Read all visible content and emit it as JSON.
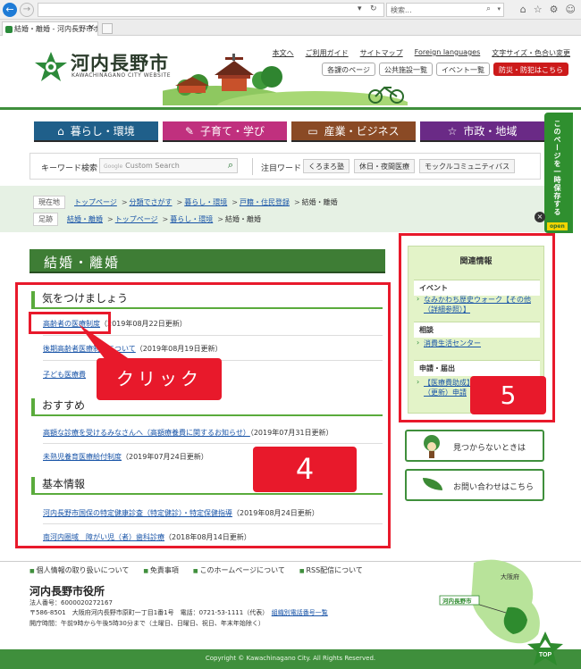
{
  "browser": {
    "search_placeholder": "検索...",
    "tab_title": "結婚・離婚 - 河内長野市ホ..."
  },
  "header": {
    "logo_text": "河内長野市",
    "logo_sub": "KAWACHINAGANO CITY WEBSITE",
    "links": [
      "本文へ",
      "ご利用ガイド",
      "サイトマップ",
      "Foreign languages",
      "文字サイズ・色合い変更"
    ],
    "buttons": [
      "各課のページ",
      "公共施設一覧",
      "イベント一覧"
    ],
    "emergency_button": "防災・防犯はこちら"
  },
  "main_nav": [
    {
      "label": "暮らし・環境",
      "color": "#1f5f8a",
      "icon": "home-icon"
    },
    {
      "label": "子育て・学び",
      "color": "#c0307e",
      "icon": "pencil-icon"
    },
    {
      "label": "産業・ビジネス",
      "color": "#8a4a25",
      "icon": "briefcase-icon"
    },
    {
      "label": "市政・地域",
      "color": "#6a2a86",
      "icon": "star-icon"
    }
  ],
  "search": {
    "keyword_label": "キーワード検索",
    "input_brand": "Google",
    "input_placeholder": "Custom Search",
    "attention_label": "注目ワード",
    "attention_items": [
      "くろまろ塾",
      "休日・夜間医療",
      "モックルコミュニティバス"
    ]
  },
  "breadcrumb": {
    "current_tag": "現在地",
    "current": [
      "トップページ",
      "分類でさがす",
      "暮らし・環境",
      "戸籍・住民登録",
      "結婚・離婚"
    ],
    "history_tag": "足跡",
    "history": [
      "結婚・離婚",
      "トップページ",
      "暮らし・環境",
      "結婚・離婚"
    ]
  },
  "save_tab": {
    "label": "このページを一時保存する",
    "open": "open"
  },
  "page_title": "結婚・離婚",
  "sections": [
    {
      "heading": "気をつけましょう",
      "items": [
        {
          "link": "高齢者の医療制度",
          "date": "（2019年08月22日更新）"
        },
        {
          "link": "後期高齢者医療制度について",
          "date": "（2019年08月19日更新）"
        },
        {
          "link": "子ども医療費",
          "date": ""
        }
      ]
    },
    {
      "heading": "おすすめ",
      "items": [
        {
          "link": "高額な診療を受けるみなさんへ（高額療養費に関するお知らせ）",
          "date": "（2019年07月31日更新）"
        },
        {
          "link": "未熟児養育医療給付制度",
          "date": "（2019年07月24日更新）"
        }
      ]
    },
    {
      "heading": "基本情報",
      "items": [
        {
          "link": "河内長野市国保の特定健康診査（特定健診）・特定保健指導",
          "date": "（2019年08月24日更新）"
        },
        {
          "link": "南河内圏域　障がい児（者）歯科診療",
          "date": "（2018年08月14日更新）"
        }
      ]
    }
  ],
  "related": {
    "title": "関連情報",
    "groups": [
      {
        "name": "イベント",
        "links": [
          "なみかわち歴史ウォーク【その他（詳細参照）】"
        ]
      },
      {
        "name": "相談",
        "links": [
          "消費生活センター"
        ]
      },
      {
        "name": "申請・届出",
        "links": [
          "【医療費助成】受給者証の交付（更新）申請"
        ]
      }
    ]
  },
  "side_buttons": [
    "見つからないときは",
    "お問い合わせはこちら"
  ],
  "annotations": {
    "click_label": "クリック",
    "badge4": "4",
    "badge5": "5"
  },
  "footer": {
    "links": [
      "個人情報の取り扱いについて",
      "免責事項",
      "このホームページについて",
      "RSS配信について"
    ],
    "city": "河内長野市役所",
    "corp_no": "法人番号：6000020272167",
    "address": "〒586-8501　大阪府河内長野市原町一丁目1番1号　電話：0721-53-1111（代表）",
    "directory_link": "組織別電話番号一覧",
    "hours": "開庁時間：午前9時から午後5時30分まで（土曜日、日曜日、祝日、年末年始除く）",
    "map_label_pref": "大阪府",
    "map_label_city": "河内長野市",
    "copyright": "Copyright © Kawachinagano City. All Rights Reserved.",
    "top_label": "TOP"
  }
}
